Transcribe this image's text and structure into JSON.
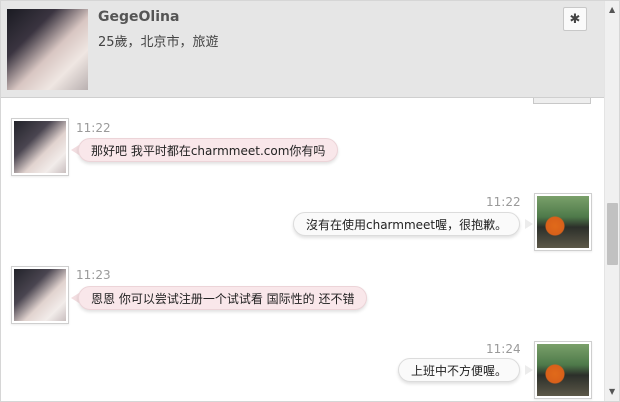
{
  "profile": {
    "name": "GegeOlina",
    "details": "25歲，北京市，旅遊",
    "settings_icon": "gear-icon"
  },
  "messages": [
    {
      "direction": "in",
      "time": "11:22",
      "text": "那好吧 我平时都在charmmeet.com你有吗"
    },
    {
      "direction": "out",
      "time": "11:22",
      "text": "沒有在使用charmmeet喔，很抱歉。"
    },
    {
      "direction": "in",
      "time": "11:23",
      "text": "恩恩 你可以尝试注册一个试试看 国际性的 还不错"
    },
    {
      "direction": "out",
      "time": "11:24",
      "text": "上班中不方便喔。"
    }
  ],
  "colors": {
    "header_bg": "#e6e6e6",
    "incoming_bubble": "#f9e7ea",
    "outgoing_bubble": "#fafafa",
    "timestamp": "#9a9a9a"
  }
}
